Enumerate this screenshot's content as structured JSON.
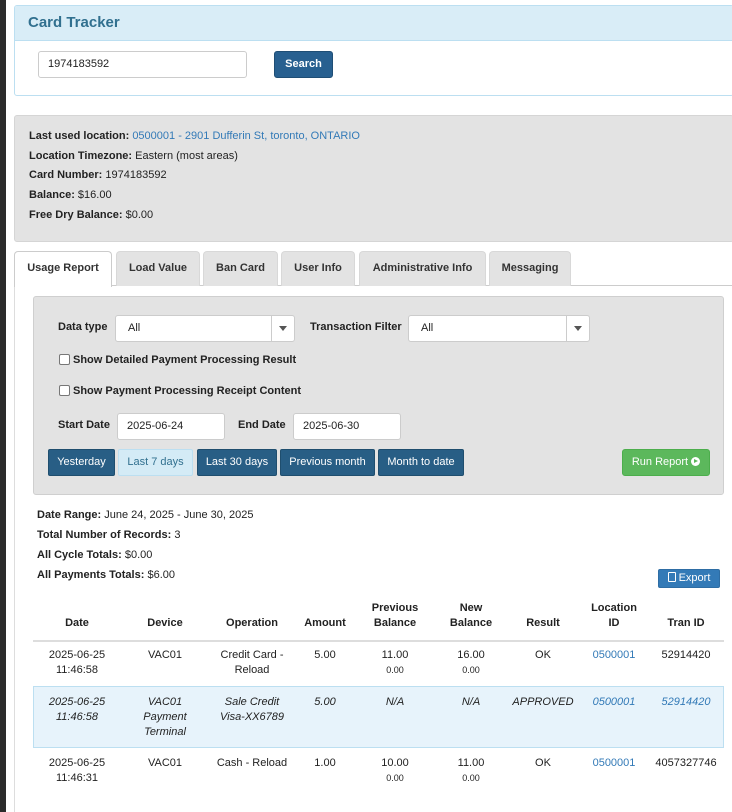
{
  "app": {
    "title": "Card Tracker"
  },
  "search": {
    "value": "1974183592",
    "button": "Search"
  },
  "info": {
    "last_used_label": "Last used location:",
    "last_used_value": "0500001 - 2901 Dufferin St, toronto, ONTARIO",
    "timezone_label": "Location Timezone:",
    "timezone_value": "Eastern (most areas)",
    "card_number_label": "Card Number:",
    "card_number_value": "1974183592",
    "balance_label": "Balance:",
    "balance_value": "$16.00",
    "free_dry_label": "Free Dry Balance:",
    "free_dry_value": "$0.00"
  },
  "tabs": [
    {
      "label": "Usage Report",
      "active": true
    },
    {
      "label": "Load Value"
    },
    {
      "label": "Ban Card"
    },
    {
      "label": "User Info"
    },
    {
      "label": "Administrative Info"
    },
    {
      "label": "Messaging"
    }
  ],
  "filters": {
    "data_type_label": "Data type",
    "data_type_value": "All",
    "transaction_filter_label": "Transaction Filter",
    "transaction_filter_value": "All",
    "show_detailed_label": "Show Detailed Payment Processing Result",
    "show_receipt_label": "Show Payment Processing Receipt Content",
    "start_date_label": "Start Date",
    "start_date_value": "2025-06-24",
    "end_date_label": "End Date",
    "end_date_value": "2025-06-30",
    "quick_ranges": [
      "Yesterday",
      "Last 7 days",
      "Last 30 days",
      "Previous month",
      "Month to date"
    ],
    "run_report": "Run Report"
  },
  "summary": {
    "date_range_label": "Date Range:",
    "date_range_value": "June 24, 2025 - June 30, 2025",
    "records_label": "Total Number of Records:",
    "records_value": "3",
    "cycle_label": "All Cycle Totals:",
    "cycle_value": "$0.00",
    "payments_label": "All Payments Totals:",
    "payments_value": "$6.00",
    "export": "Export"
  },
  "table": {
    "headers": {
      "date": "Date",
      "device": "Device",
      "operation": "Operation",
      "amount": "Amount",
      "prev1": "Previous",
      "prev2": "Balance",
      "new1": "New",
      "new2": "Balance",
      "result": "Result",
      "loc1": "Location",
      "loc2": "ID",
      "tran": "Tran ID"
    },
    "rows": [
      {
        "date1": "2025-06-25",
        "date2": "11:46:58",
        "device1": "VAC01",
        "device2": "",
        "device3": "",
        "op1": "Credit Card -",
        "op2": "Reload",
        "amount": "5.00",
        "prev": "11.00",
        "prev_sub": "0.00",
        "new": "16.00",
        "new_sub": "0.00",
        "result": "OK",
        "location": "0500001",
        "tran": "52914420"
      },
      {
        "date1": "2025-06-25",
        "date2": "11:46:58",
        "device1": "VAC01",
        "device2": "Payment",
        "device3": "Terminal",
        "op1": "Sale Credit",
        "op2": "Visa-XX6789",
        "amount": "5.00",
        "prev": "N/A",
        "prev_sub": "",
        "new": "N/A",
        "new_sub": "",
        "result": "APPROVED",
        "location": "0500001",
        "tran": "52914420"
      },
      {
        "date1": "2025-06-25",
        "date2": "11:46:31",
        "device1": "VAC01",
        "device2": "",
        "device3": "",
        "op1": "Cash - Reload",
        "op2": "",
        "amount": "1.00",
        "prev": "10.00",
        "prev_sub": "0.00",
        "new": "11.00",
        "new_sub": "0.00",
        "result": "OK",
        "location": "0500001",
        "tran": "4057327746"
      }
    ]
  },
  "colors": {
    "primary": "#286090",
    "info_bg": "#d9edf7",
    "success": "#5cb85c",
    "link": "#337ab7"
  }
}
